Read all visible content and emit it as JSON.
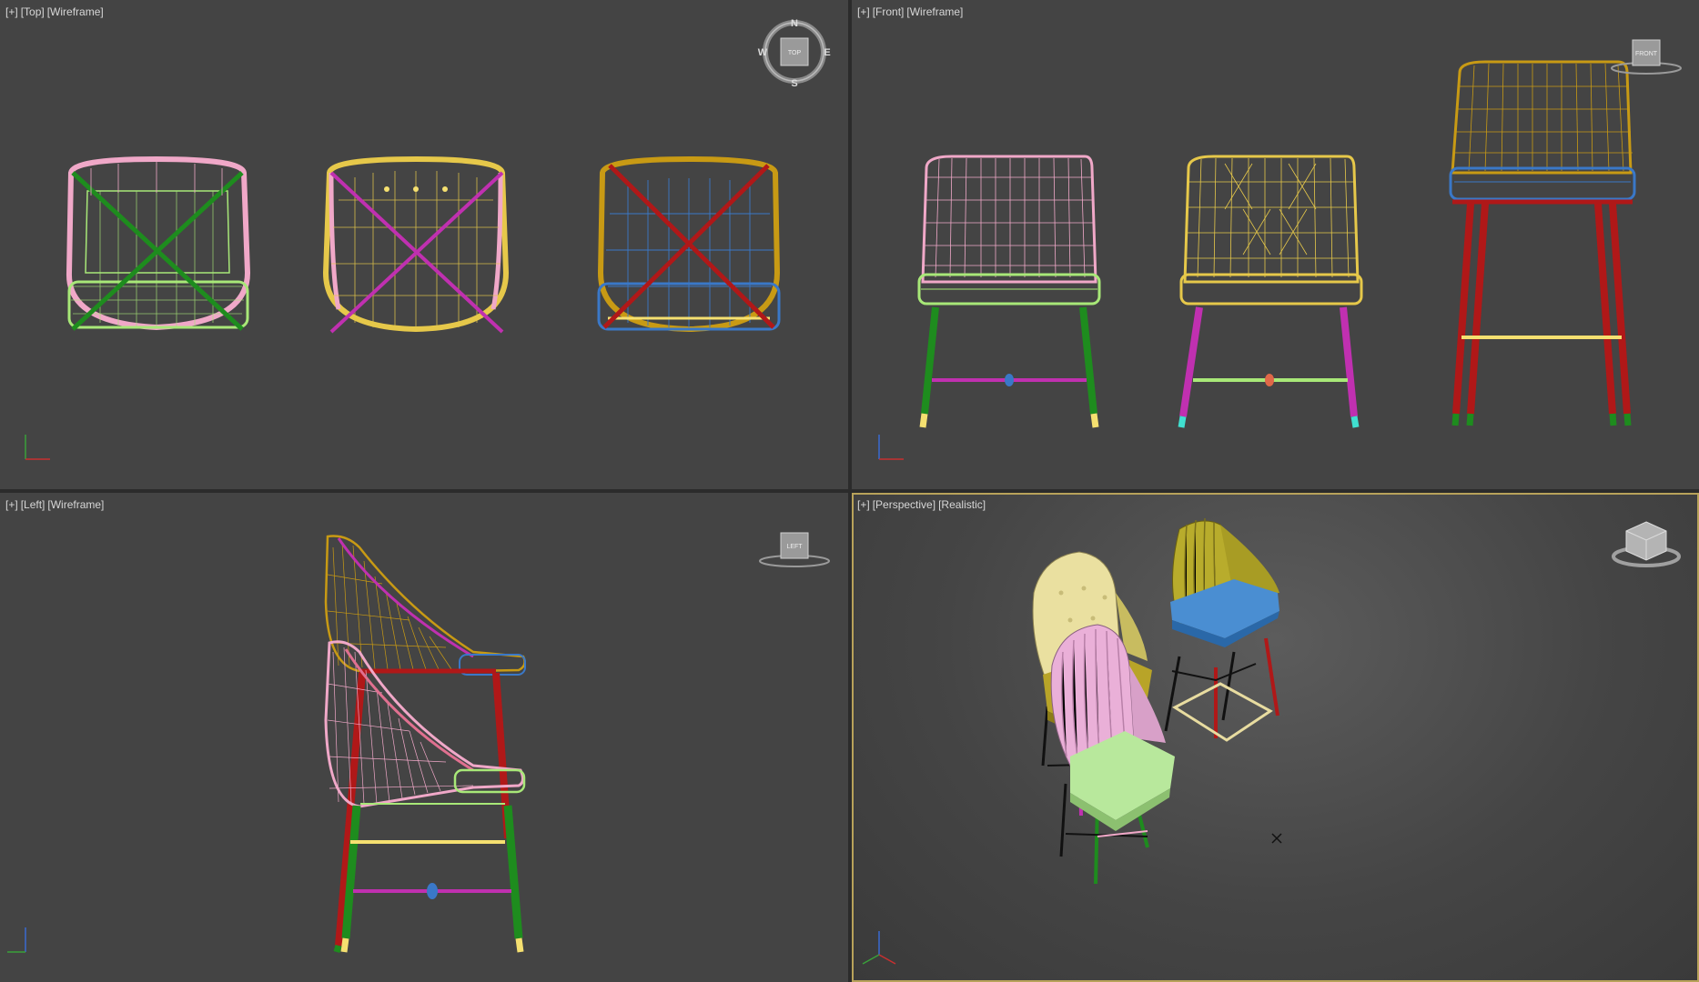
{
  "viewports": {
    "top": {
      "menu": "[+]",
      "view": "[Top]",
      "shading": "[Wireframe]",
      "cube_label": "TOP"
    },
    "front": {
      "menu": "[+]",
      "view": "[Front]",
      "shading": "[Wireframe]",
      "cube_label": "FRONT"
    },
    "left": {
      "menu": "[+]",
      "view": "[Left]",
      "shading": "[Wireframe]",
      "cube_label": "LEFT"
    },
    "persp": {
      "menu": "[+]",
      "view": "[Perspective]",
      "shading": "[Realistic]"
    }
  },
  "compass": {
    "n": "N",
    "s": "S",
    "e": "E",
    "w": "W"
  },
  "axis_labels": {
    "x": "x",
    "y": "y",
    "z": "z"
  },
  "colors": {
    "viewport_bg": "#444444",
    "active_border": "#b8a25a",
    "chair1_back": "#f0a8c8",
    "chair1_seat": "#a8e878",
    "chair1_legs": "#1e8c1e",
    "chair2_back": "#e6c84a",
    "chair2_legs": "#c030b0",
    "chair3_back": "#c89a14",
    "chair3_seat": "#3a78c8",
    "chair3_legs": "#b01818"
  }
}
